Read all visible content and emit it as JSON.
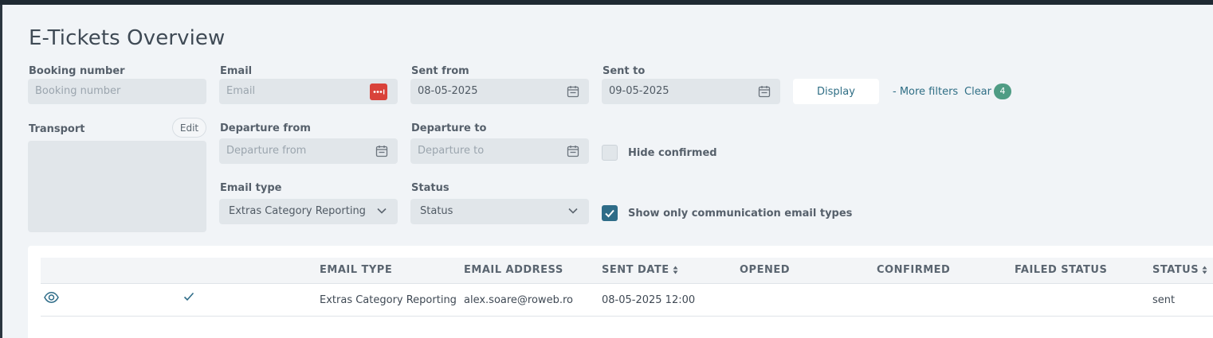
{
  "page": {
    "title": "E-Tickets Overview"
  },
  "filters": {
    "booking_number": {
      "label": "Booking number",
      "placeholder": "Booking number",
      "value": ""
    },
    "email": {
      "label": "Email",
      "placeholder": "Email",
      "value": ""
    },
    "sent_from": {
      "label": "Sent from",
      "value": "08-05-2025"
    },
    "sent_to": {
      "label": "Sent to",
      "value": "09-05-2025"
    },
    "display_label": "Display",
    "more_filters_label": "- More filters",
    "clear_label": "Clear",
    "active_filter_count": "4",
    "transport": {
      "label": "Transport",
      "edit_label": "Edit"
    },
    "departure_from": {
      "label": "Departure from",
      "placeholder": "Departure from",
      "value": ""
    },
    "departure_to": {
      "label": "Departure to",
      "placeholder": "Departure to",
      "value": ""
    },
    "hide_confirmed": {
      "label": "Hide confirmed",
      "checked": false
    },
    "email_type": {
      "label": "Email type",
      "value": "Extras Category Reporting"
    },
    "status": {
      "label": "Status",
      "value": "Status"
    },
    "show_only_communication": {
      "label": "Show only communication email types",
      "checked": true
    }
  },
  "table": {
    "columns": [
      "EMAIL TYPE",
      "EMAIL ADDRESS",
      "SENT DATE",
      "OPENED",
      "CONFIRMED",
      "FAILED STATUS",
      "STATUS"
    ],
    "rows": [
      {
        "email_type": "Extras Category Reporting",
        "email_address": "alex.soare@roweb.ro",
        "sent_date": "08-05-2025 12:00",
        "opened": "",
        "confirmed": "",
        "failed_status": "",
        "status": "sent"
      }
    ]
  },
  "colors": {
    "accent": "#2e6c88",
    "badge": "#4f9c84",
    "password_manager": "#d9423a",
    "topbar": "#1f2a33"
  },
  "icons": {
    "calendar": "calendar-icon",
    "password_manager": "password-manager-icon",
    "chevron": "chevron-down-icon",
    "sort": "sort-icon",
    "view": "eye-icon",
    "check": "checkmark-icon"
  }
}
